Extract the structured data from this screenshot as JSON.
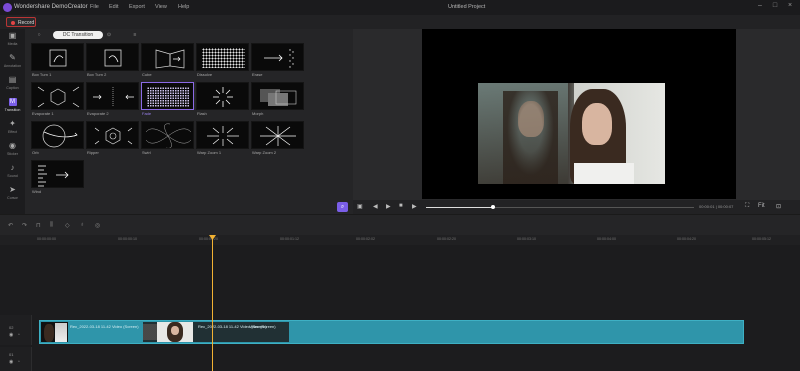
{
  "window": {
    "app_title": "Wondershare DemoCreator",
    "project_title": "Untitled Project",
    "menu": [
      "File",
      "Edit",
      "Export",
      "View",
      "Help"
    ]
  },
  "record": {
    "label": "Record"
  },
  "sidebar": {
    "items": [
      {
        "label": "Media",
        "icon": "media-icon"
      },
      {
        "label": "Annotation",
        "icon": "annotation-icon"
      },
      {
        "label": "Caption",
        "icon": "caption-icon"
      },
      {
        "label": "Transition",
        "icon": "transition-icon",
        "active": true
      },
      {
        "label": "Effect",
        "icon": "effect-icon"
      },
      {
        "label": "Sticker",
        "icon": "sticker-icon"
      },
      {
        "label": "Sound",
        "icon": "sound-icon"
      },
      {
        "label": "Cursor",
        "icon": "cursor-icon"
      }
    ]
  },
  "library": {
    "active_tab": "DC Transition",
    "transitions": [
      "Box Turn 1",
      "Box Turn 2",
      "Cube",
      "Dissolve",
      "Erase",
      "Evaporate 1",
      "Evaporate 2",
      "Fade",
      "Flash",
      "Morph",
      "Orb",
      "Ripper",
      "Swirl",
      "Warp Zoom 1",
      "Warp Zoom 2",
      "Wind"
    ],
    "selected": "Fade"
  },
  "player": {
    "timecode": "00:00:01 | 00:00:07",
    "progress": 0.25,
    "zoom_label": "Fit"
  },
  "timeline": {
    "ruler": [
      "00:00:00:00",
      "00:00:00:10",
      "00:00:00:20",
      "00:00:01:12",
      "00:00:02:02",
      "00:00:02:20",
      "00:00:03:10",
      "00:00:04:00",
      "00:00:04:20",
      "00:00:05:12",
      "00:00:06:02"
    ],
    "tracks": [
      {
        "number": "02"
      },
      {
        "number": "01"
      }
    ],
    "clip": {
      "label_a": "Rec_2022-03-18 11-42 Video (Screen)",
      "label_b": "Rec_2022-03-18 11-42 Video (Screen)",
      "label_c": "Video (Screen)"
    }
  },
  "colors": {
    "accent": "#7a5ee8",
    "clip": "#2f95aa",
    "playhead": "#f2b233",
    "record": "#e24545"
  }
}
